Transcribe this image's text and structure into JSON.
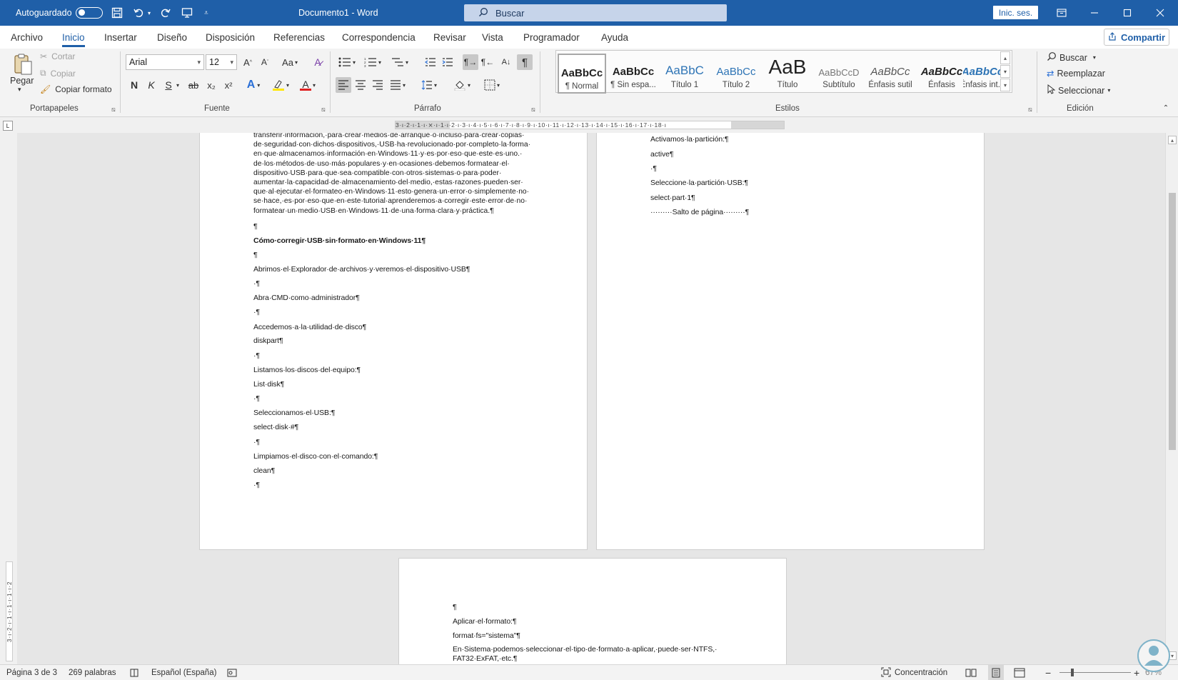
{
  "titlebar": {
    "autosave_label": "Autoguardado",
    "doc_title": "Documento1  -  Word",
    "search_placeholder": "Buscar",
    "signin_label": "Inic. ses.",
    "save_icon": "save-icon",
    "undo_icon": "undo-icon",
    "redo_icon": "redo-icon"
  },
  "tabs": [
    "Archivo",
    "Inicio",
    "Insertar",
    "Diseño",
    "Disposición",
    "Referencias",
    "Correspondencia",
    "Revisar",
    "Vista",
    "Programador",
    "Ayuda"
  ],
  "share_label": "Compartir",
  "ribbon": {
    "clipboard": {
      "paste": "Pegar",
      "cut": "Cortar",
      "copy": "Copiar",
      "format_painter": "Copiar formato",
      "label": "Portapapeles"
    },
    "font": {
      "name": "Arial",
      "size": "12",
      "label": "Fuente",
      "bold": "N",
      "italic": "K",
      "underline": "S",
      "strike": "ab",
      "sub": "x₂",
      "sup": "x²",
      "case": "Aa"
    },
    "paragraph": {
      "label": "Párrafo"
    },
    "styles": {
      "label": "Estilos",
      "items": [
        {
          "preview": "AaBbCc",
          "name": "¶ Normal"
        },
        {
          "preview": "AaBbCc",
          "name": "¶ Sin espa..."
        },
        {
          "preview": "AaBbC",
          "name": "Título 1"
        },
        {
          "preview": "AaBbCc",
          "name": "Título 2"
        },
        {
          "preview": "AaB",
          "name": "Título"
        },
        {
          "preview": "AaBbCcD",
          "name": "Subtítulo"
        },
        {
          "preview": "AaBbCc",
          "name": "Énfasis sutil"
        },
        {
          "preview": "AaBbCc",
          "name": "Énfasis"
        },
        {
          "preview": "AaBbCc",
          "name": "Énfasis int..."
        }
      ]
    },
    "editing": {
      "label": "Edición",
      "find": "Buscar",
      "replace": "Reemplazar",
      "select": "Seleccionar"
    }
  },
  "ruler_text": "3·ı·2·ı·1·ı·⨯·ı·1·ı·2·ı·3·ı·4·ı·5·ı·6·ı·7·ı·8·ı·9·ı·10·ı·11·ı·12·ı·13·ı·14·ı·15·ı·16·ı·17·ı·18·ı",
  "vruler_text": "3·ı·2·ı·1·ı·1·ı·1·ı·2",
  "page1": {
    "intro_lines": [
      "transferir·información,·para·crear·medios·de·arranque·o·incluso·para·crear·copias·",
      "de·seguridad·con·dichos·dispositivos,·USB·ha·revolucionado·por·completo·la·forma·",
      "en·que·almacenamos·información·en·Windows·11·y·es·por·eso·que·este·es·uno.·",
      "de·los·métodos·de·uso·más·populares·y·en·ocasiones·debemos·formatear·el·",
      "dispositivo·USB·para·que·sea·compatible·con·otros·sistemas·o·para·poder·",
      "aumentar·la·capacidad·de·almacenamiento·del·medio,·estas·razones·pueden·ser·",
      "que·al·ejecutar·el·formateo·en·Windows·11·esto·genera·un·error·o·simplemente·no·",
      "se·hace,·es·por·eso·que·en·este·tutorial·aprenderemos·a·corregir·este·error·de·no·",
      "formatear·un·medio·USB·en·Windows·11·de·una·forma·clara·y·práctica.¶"
    ],
    "pilcrow_1": "¶",
    "heading": "Cómo·corregir·USB·sin·formato·en·Windows·11¶",
    "pilcrow_2": "¶",
    "line_1": "Abrimos·el·Explorador·de·archivos·y·veremos·el·dispositivo·USB¶",
    "pilcrow_3": "·¶",
    "line_2": "Abra·CMD·como·administrador¶",
    "pilcrow_4": "·¶",
    "line_3": "Accedemos·a·la·utilidad·de·disco¶",
    "line_4": "diskpart¶",
    "pilcrow_5": "·¶",
    "line_5": "Listamos·los·discos·del·equipo:¶",
    "line_6": "List·disk¶",
    "pilcrow_6": "·¶",
    "line_7": "Seleccionamos·el·USB:¶",
    "line_8": "select·disk·#¶",
    "pilcrow_7": "·¶",
    "line_9": "Limpiamos·el·disco·con·el·comando:¶",
    "line_10": "clean¶",
    "pilcrow_8": "·¶"
  },
  "page2": {
    "line_1": "Activamos·la·partición:¶",
    "line_2": "active¶",
    "pilcrow_1": "·¶",
    "line_3": "Seleccione·la·partición·USB:¶",
    "line_4": "select·part·1¶",
    "page_break": "·········Salto de página·········¶"
  },
  "page3": {
    "pilcrow_1": "¶",
    "line_1": "Aplicar·el·formato:¶",
    "line_2": "format·fs=\"sistema\"¶",
    "line_3": "En·Sistema·podemos·seleccionar·el·tipo·de·formato·a·aplicar,·puede·ser·NTFS,·",
    "line_4": "FAT32·ExFAT,·etc.¶"
  },
  "statusbar": {
    "page": "Página 3 de 3",
    "words": "269 palabras",
    "language": "Español (España)",
    "focus": "Concentración",
    "zoom": "67%"
  },
  "colors": {
    "titlebar": "#1f5fa8",
    "accent": "#1f5fa8"
  }
}
